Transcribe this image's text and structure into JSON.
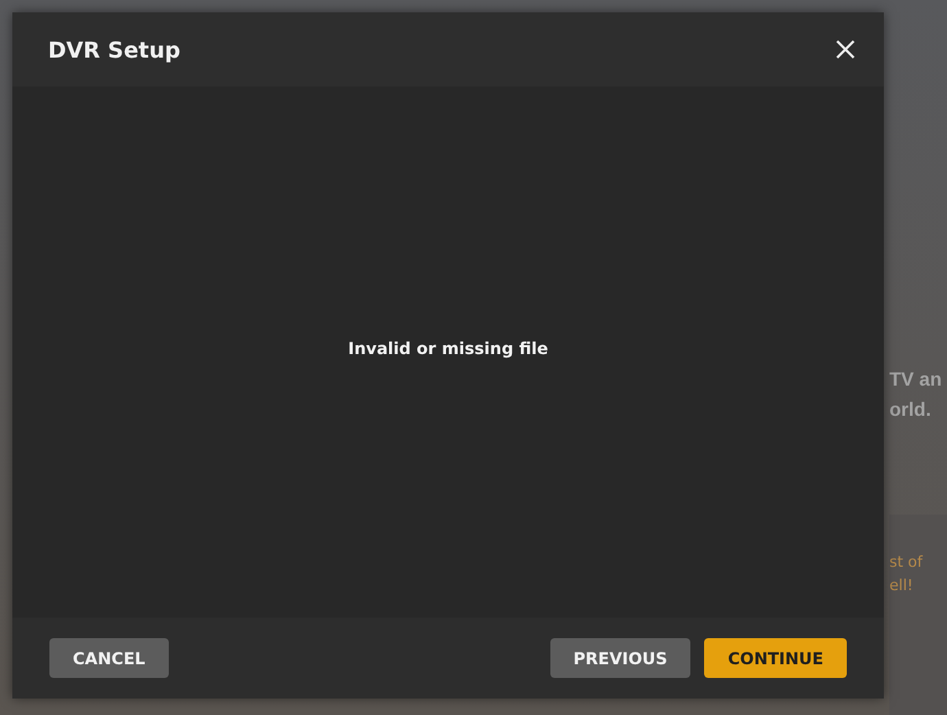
{
  "background": {
    "intro": [
      "TV an",
      "orld."
    ],
    "promo": [
      "st of",
      "ell!"
    ]
  },
  "dialog": {
    "title": "DVR Setup",
    "message": "Invalid or missing file",
    "buttons": [
      {
        "label": "CANCEL",
        "kind": "secondary"
      },
      {
        "label": "PREVIOUS",
        "kind": "secondary"
      },
      {
        "label": "CONTINUE",
        "kind": "primary"
      }
    ]
  }
}
